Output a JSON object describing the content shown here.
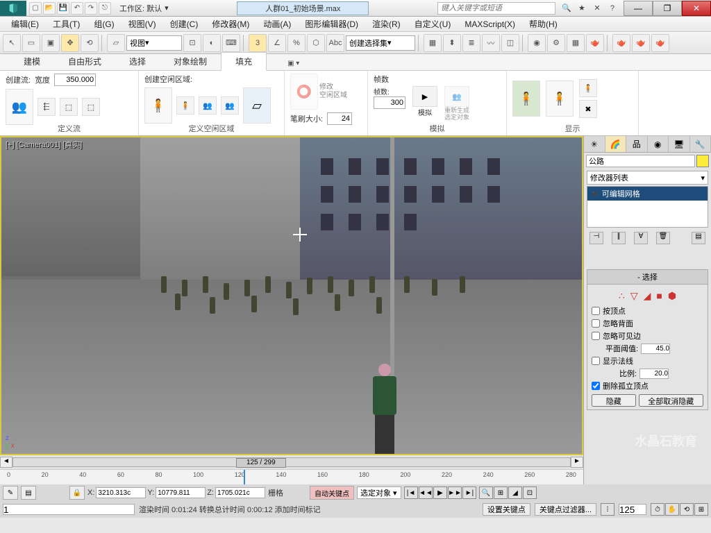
{
  "title": {
    "workspace_label": "工作区: 默认",
    "filename": "人群01_初始场景.max",
    "search_placeholder": "键入关键字或短语"
  },
  "menubar": [
    "编辑(E)",
    "工具(T)",
    "组(G)",
    "视图(V)",
    "创建(C)",
    "修改器(M)",
    "动画(A)",
    "图形编辑器(D)",
    "渲染(R)",
    "自定义(U)",
    "MAXScript(X)",
    "帮助(H)"
  ],
  "maintoolbar": {
    "ref_combo": "视图",
    "named_sel": "创建选择集"
  },
  "ribbon": {
    "tabs": [
      "建模",
      "自由形式",
      "选择",
      "对象绘制",
      "填充"
    ],
    "active_tab": "填充",
    "groups": {
      "flow": {
        "create_label": "创建流:",
        "width_label": "宽度",
        "width_value": "350.000",
        "group_label": "定义流"
      },
      "idle": {
        "create_label": "创建空闲区域:",
        "group_label": "定义空闲区域"
      },
      "brush": {
        "modify_label": "修改",
        "idle_area_label": "空闲区域",
        "brush_label": "笔刷大小:",
        "brush_value": "24"
      },
      "sim": {
        "frames_label": "帧数",
        "frames_sub": "帧数:",
        "frames_value": "300",
        "sim_btn": "模拟",
        "regen_btn": "重新生成",
        "regen_sub": "选定对象",
        "group_label": "模拟"
      },
      "display": {
        "group_label": "显示"
      }
    }
  },
  "viewport": {
    "label": "[+] [Camera001] [真实]"
  },
  "timeslider": {
    "frame_display": "125 / 299"
  },
  "timeline_ticks": [
    "0",
    "20",
    "40",
    "60",
    "80",
    "100",
    "120",
    "140",
    "160",
    "180",
    "200",
    "220",
    "240",
    "260",
    "280"
  ],
  "status1": {
    "x_label": "X:",
    "x_val": "3210.313c",
    "y_label": "Y:",
    "y_val": "10779.811",
    "z_label": "Z:",
    "z_val": "1705.021c",
    "grid_label": "栅格",
    "autokey": "自动关键点",
    "selected": "选定对象"
  },
  "status2": {
    "prompt": "渲染时间  0:01:24   转换总计时间  0:00:12   添加时间标记",
    "setkey": "设置关键点",
    "keyfilter": "关键点过滤器...",
    "cur_frame": "125"
  },
  "cmdpanel": {
    "obj_name": "公路",
    "modlist": "修改器列表",
    "stack_item": "可编辑网格",
    "rollout_sel": "选择",
    "chk_vertex": "按顶点",
    "chk_backface": "忽略背面",
    "chk_visedge": "忽略可见边",
    "plane_thresh_label": "平面阈值:",
    "plane_thresh_val": "45.0",
    "chk_normals": "显示法线",
    "scale_label": "比例:",
    "scale_val": "20.0",
    "chk_isolated": "删除孤立顶点",
    "hide_btn": "隐藏",
    "unhide_btn": "全部取消隐藏"
  },
  "watermark": "水晶石教育"
}
